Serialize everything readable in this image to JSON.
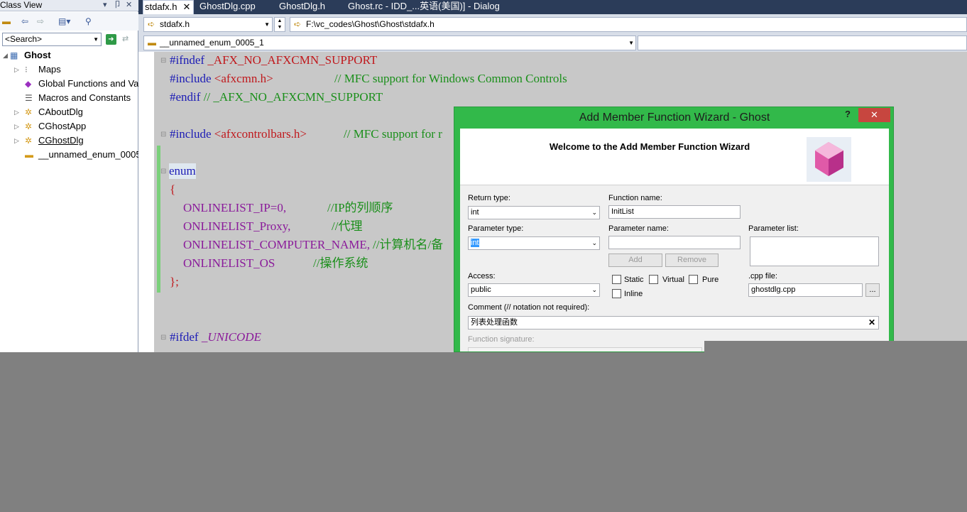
{
  "class_view": {
    "title": "Class View",
    "search_text": "<Search>",
    "tree": [
      {
        "label": "Ghost",
        "icon": "project-icon",
        "bold": true
      },
      {
        "label": "Maps",
        "icon": "maps-icon"
      },
      {
        "label": "Global Functions and Va",
        "icon": "global-functions-icon"
      },
      {
        "label": "Macros and Constants",
        "icon": "macros-icon"
      },
      {
        "label": "CAboutDlg",
        "icon": "class-icon"
      },
      {
        "label": "CGhostApp",
        "icon": "class-icon"
      },
      {
        "label": "CGhostDlg",
        "icon": "class-icon"
      },
      {
        "label": "__unnamed_enum_0005_",
        "icon": "enum-icon"
      }
    ]
  },
  "tabs": [
    "stdafx.h",
    "GhostDlg.cpp",
    "GhostDlg.h",
    "Ghost.rc - IDD_...英语(美国)] - Dialog"
  ],
  "nav": {
    "file_combo": "stdafx.h",
    "path": "F:\\vc_codes\\Ghost\\Ghost\\stdafx.h",
    "member_combo": "__unnamed_enum_0005_1"
  },
  "code": {
    "l1a": "#ifndef",
    "l1b": " _AFX_NO_AFXCMN_SUPPORT",
    "l2a": "#include",
    "l2b": " <afxcmn.h>",
    "l2c": "// MFC support for Windows Common Controls",
    "l3a": "#endif",
    "l3b": " // _AFX_NO_AFXCMN_SUPPORT",
    "l4a": "#include",
    "l4b": " <afxcontrolbars.h>",
    "l4c": "// MFC support for r",
    "l5": "enum",
    "l6": "{",
    "l7a": "ONLINELIST_IP=0,",
    "l7b": "//IP的列顺序",
    "l8a": "ONLINELIST_Proxy,",
    "l8b": "//代理",
    "l9a": "ONLINELIST_COMPUTER_NAME,",
    "l9b": " //计算机名/备",
    "l10a": "ONLINELIST_OS",
    "l10b": "//操作系统",
    "l11": "};",
    "l12a": "#ifdef",
    "l12b": " _UNICODE"
  },
  "dialog": {
    "title": "Add Member Function Wizard - Ghost",
    "help": "?",
    "close": "✕",
    "welcome": "Welcome to the Add Member Function Wizard",
    "return_type_label": "Return type:",
    "return_type_value": "int",
    "function_name_label": "Function name:",
    "function_name_value": "InitList",
    "param_type_label": "Parameter type:",
    "param_type_value": "int",
    "param_name_label": "Parameter name:",
    "param_list_label": "Parameter list:",
    "add_button": "Add",
    "remove_button": "Remove",
    "access_label": "Access:",
    "access_value": "public",
    "static_label": "Static",
    "virtual_label": "Virtual",
    "pure_label": "Pure",
    "inline_label": "Inline",
    "cpp_file_label": ".cpp file:",
    "cpp_file_value": "ghostdlg.cpp",
    "browse_button": "...",
    "comment_label": "Comment (// notation not required):",
    "comment_value": "列表处理函数",
    "signature_label": "Function signature:"
  }
}
